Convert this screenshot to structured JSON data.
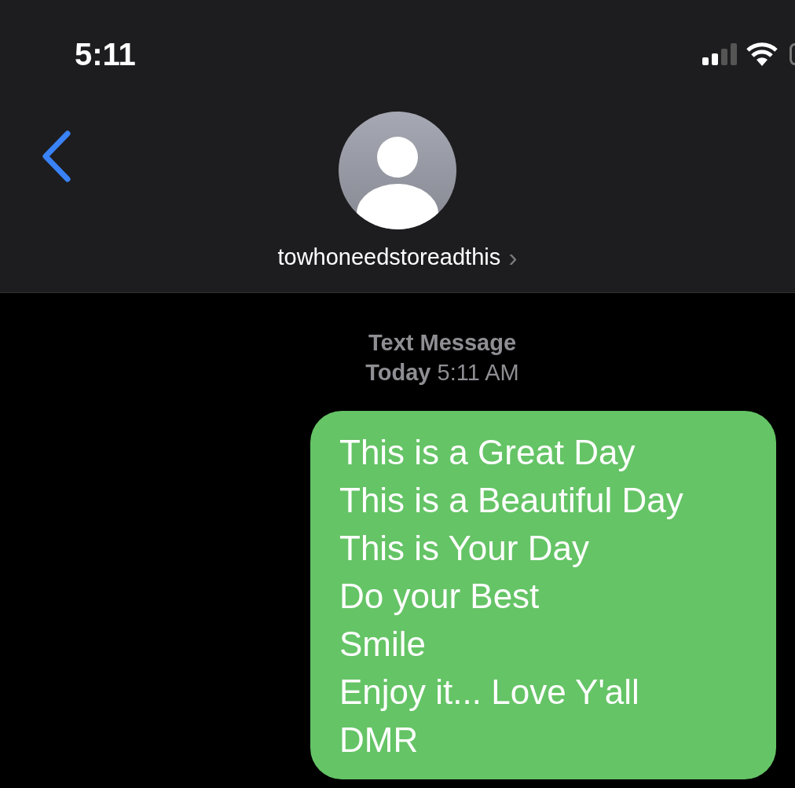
{
  "status_bar": {
    "time": "5:11"
  },
  "header": {
    "contact_name": "towhoneedstoreadthis",
    "chevron": "›"
  },
  "conversation": {
    "service": "Text Message",
    "timestamp": "**Today** 5:11 AM",
    "messages": [
      {
        "kind": "sent",
        "text": "This is a Great Day\nThis is a Beautiful Day\nThis is Your Day\nDo your Best\nSmile\nEnjoy it... Love Y'all\nDMR"
      }
    ]
  }
}
